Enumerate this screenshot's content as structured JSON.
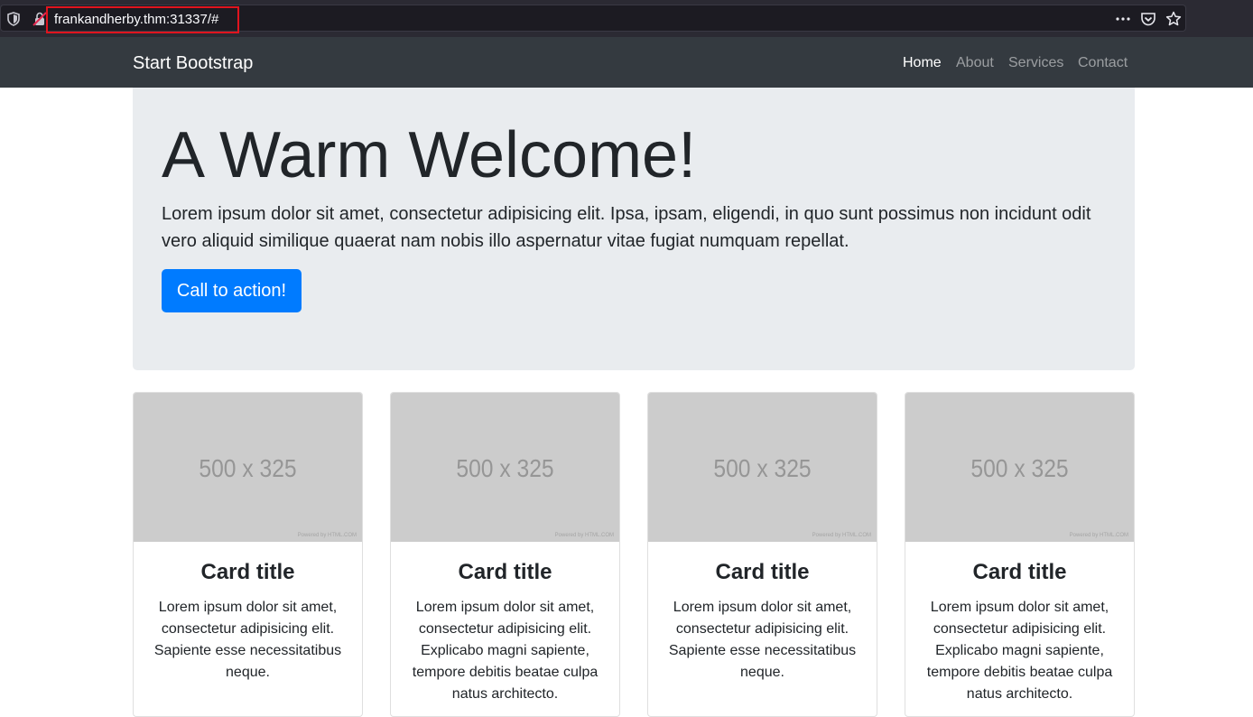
{
  "browser": {
    "url": "frankandherby.thm:31337/#",
    "icons": [
      "shield-icon",
      "insecure-lock-icon",
      "more-icon",
      "pocket-icon",
      "star-icon"
    ]
  },
  "navbar": {
    "brand": "Start Bootstrap",
    "links": [
      {
        "label": "Home",
        "active": true
      },
      {
        "label": "About",
        "active": false
      },
      {
        "label": "Services",
        "active": false
      },
      {
        "label": "Contact",
        "active": false
      }
    ]
  },
  "jumbotron": {
    "title": "A Warm Welcome!",
    "lead": "Lorem ipsum dolor sit amet, consectetur adipisicing elit. Ipsa, ipsam, eligendi, in quo sunt possimus non incidunt odit vero aliquid similique quaerat nam nobis illo aspernatur vitae fugiat numquam repellat.",
    "cta": "Call to action!"
  },
  "cards": [
    {
      "image_label": "500 x 325",
      "image_credit": "Powered by HTML.COM",
      "title": "Card title",
      "text": "Lorem ipsum dolor sit amet, consectetur adipisicing elit. Sapiente esse necessitatibus neque."
    },
    {
      "image_label": "500 x 325",
      "image_credit": "Powered by HTML.COM",
      "title": "Card title",
      "text": "Lorem ipsum dolor sit amet, consectetur adipisicing elit. Explicabo magni sapiente, tempore debitis beatae culpa natus architecto."
    },
    {
      "image_label": "500 x 325",
      "image_credit": "Powered by HTML.COM",
      "title": "Card title",
      "text": "Lorem ipsum dolor sit amet, consectetur adipisicing elit. Sapiente esse necessitatibus neque."
    },
    {
      "image_label": "500 x 325",
      "image_credit": "Powered by HTML.COM",
      "title": "Card title",
      "text": "Lorem ipsum dolor sit amet, consectetur adipisicing elit. Explicabo magni sapiente, tempore debitis beatae culpa natus architecto."
    }
  ],
  "colors": {
    "navbar_bg": "#343a40",
    "jumbotron_bg": "#e9ecef",
    "primary": "#007bff",
    "url_highlight": "#e0141e"
  }
}
